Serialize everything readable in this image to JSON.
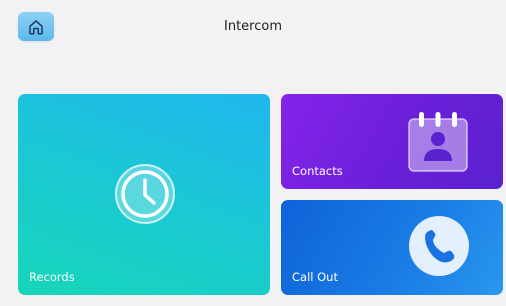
{
  "header": {
    "title": "Intercom",
    "home_icon": "home-icon"
  },
  "tiles": {
    "records": {
      "label": "Records",
      "icon": "clock-icon"
    },
    "contacts": {
      "label": "Contacts",
      "icon": "contact-card-icon"
    },
    "call_out": {
      "label": "Call Out",
      "icon": "phone-icon"
    }
  },
  "colors": {
    "background": "#f2f2f4",
    "home_button": "#5bb8ec",
    "records_gradient": [
      "#20b6ee",
      "#16d6b8"
    ],
    "contacts_gradient": [
      "#8524ea",
      "#5a22cf"
    ],
    "callout_gradient": [
      "#0f62d8",
      "#2a97ee"
    ]
  }
}
